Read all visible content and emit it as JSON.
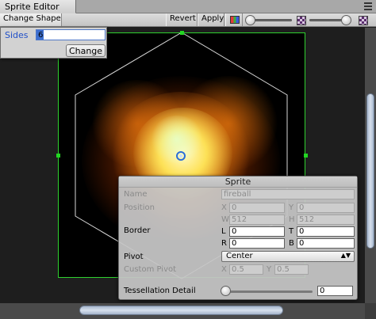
{
  "window": {
    "tab_title": "Sprite Editor"
  },
  "toolbar": {
    "change_shape": "Change Shape",
    "revert": "Revert",
    "apply": "Apply",
    "color_toggle_icon": "rgb-channel-icon",
    "zoom_slider_value": 0.05,
    "alpha_slider_value": 0.95
  },
  "change_shape_popup": {
    "sides_label": "Sides",
    "sides_value": "6",
    "change_button": "Change"
  },
  "sprite_panel": {
    "title": "Sprite",
    "name_label": "Name",
    "name_value": "fireball",
    "position_label": "Position",
    "x_axis": "X",
    "y_axis": "Y",
    "w_axis": "W",
    "h_axis": "H",
    "pos_x": "0",
    "pos_y": "0",
    "pos_w": "512",
    "pos_h": "512",
    "border_label": "Border",
    "l_axis": "L",
    "t_axis": "T",
    "r_axis": "R",
    "b_axis": "B",
    "border_l": "0",
    "border_t": "0",
    "border_r": "0",
    "border_b": "0",
    "pivot_label": "Pivot",
    "pivot_value": "Center",
    "custom_pivot_label": "Custom Pivot",
    "custom_x": "0.5",
    "custom_y": "0.5",
    "tessellation_label": "Tessellation Detail",
    "tessellation_value": "0",
    "tessellation_slider_value": 0
  },
  "colors": {
    "outline": "#2fd12f",
    "shape_line": "#d8d8d8",
    "pivot": "#2c6fd8"
  }
}
